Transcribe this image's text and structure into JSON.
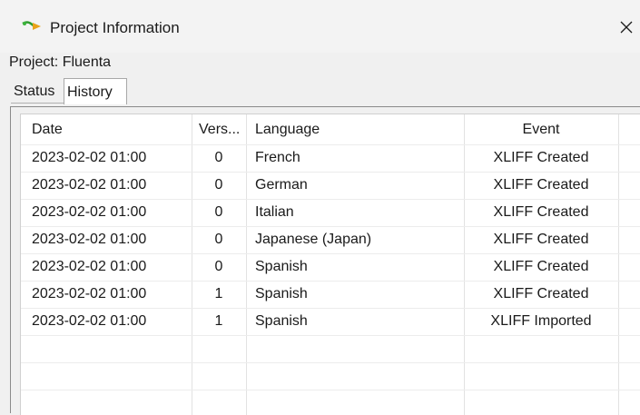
{
  "window": {
    "title": "Project Information",
    "close_glyph": "✕",
    "icon": "app-arrow-icon"
  },
  "project": {
    "label": "Project: Fluenta"
  },
  "tabs": [
    {
      "label": "Status",
      "selected": false
    },
    {
      "label": "History",
      "selected": true
    }
  ],
  "table": {
    "headers": {
      "date": "Date",
      "version": "Vers...",
      "language": "Language",
      "event": "Event"
    },
    "rows": [
      {
        "date": "2023-02-02 01:00",
        "version": "0",
        "language": "French",
        "event": "XLIFF Created"
      },
      {
        "date": "2023-02-02 01:00",
        "version": "0",
        "language": "German",
        "event": "XLIFF Created"
      },
      {
        "date": "2023-02-02 01:00",
        "version": "0",
        "language": "Italian",
        "event": "XLIFF Created"
      },
      {
        "date": "2023-02-02 01:00",
        "version": "0",
        "language": "Japanese (Japan)",
        "event": "XLIFF Created"
      },
      {
        "date": "2023-02-02 01:00",
        "version": "0",
        "language": "Spanish",
        "event": "XLIFF Created"
      },
      {
        "date": "2023-02-02 01:00",
        "version": "1",
        "language": "Spanish",
        "event": "XLIFF Created"
      },
      {
        "date": "2023-02-02 01:00",
        "version": "1",
        "language": "Spanish",
        "event": "XLIFF Imported"
      }
    ]
  }
}
